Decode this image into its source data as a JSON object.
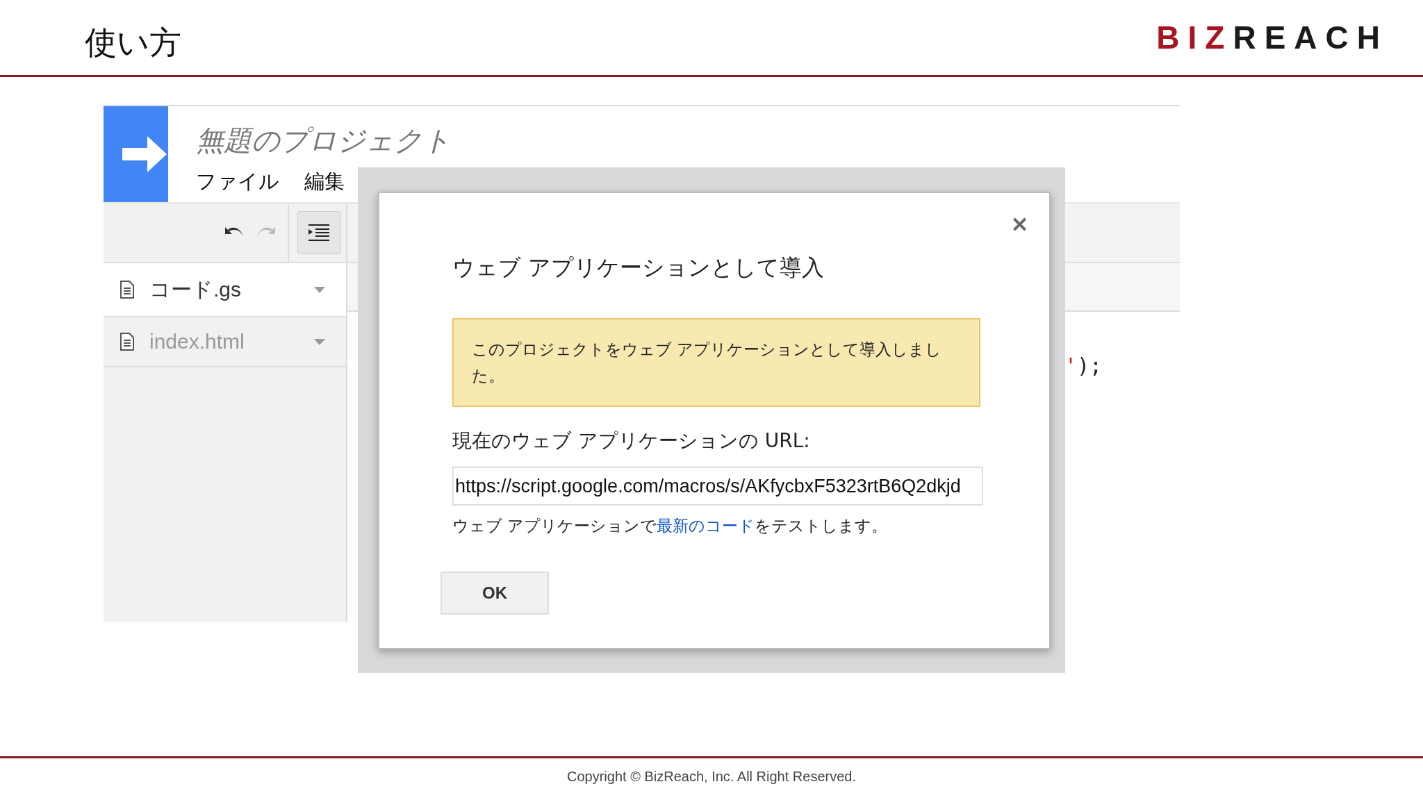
{
  "slide": {
    "title": "使い方",
    "logo": [
      {
        "text": "BIZ",
        "kind": "accent"
      },
      {
        "text": "REACH",
        "kind": "plain"
      }
    ],
    "footer": "Copyright © BizReach, Inc. All Right Reserved."
  },
  "editor": {
    "project_title": "無題のプロジェクト",
    "menu": [
      "ファイル",
      "編集"
    ],
    "files": [
      {
        "name": "コード.gs",
        "selected": true
      },
      {
        "name": "index.html",
        "selected": false
      }
    ],
    "code": [
      {
        "text": "'",
        "kind": "string"
      },
      {
        "text": ");",
        "kind": "punct"
      }
    ]
  },
  "dialog": {
    "title": "ウェブ アプリケーションとして導入",
    "notice": "このプロジェクトをウェブ アプリケーションとして導入しました。",
    "url_label": "現在のウェブ アプリケーションの URL:",
    "url": "https://script.google.com/macros/s/AKfycbxF5323rtB6Q2dkjd",
    "hint_before": "ウェブ アプリケーションで",
    "hint_link": "最新のコード",
    "hint_after": "をテストします。",
    "ok": "OK",
    "close": "✕"
  }
}
